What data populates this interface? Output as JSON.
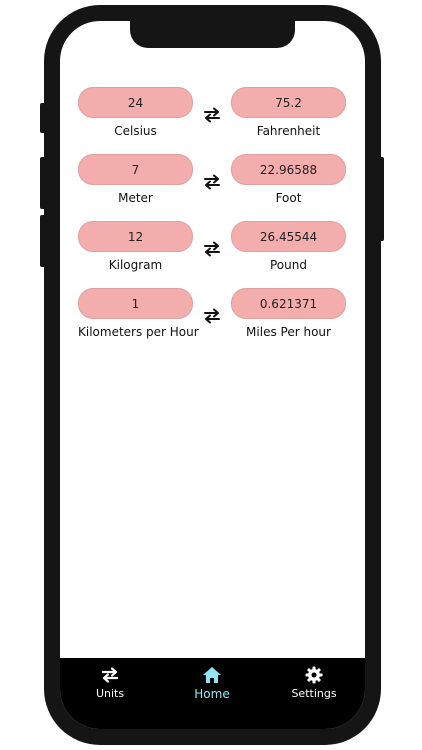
{
  "conversions": [
    {
      "left_value": "24",
      "left_unit": "Celsius",
      "right_value": "75.2",
      "right_unit": "Fahrenheit"
    },
    {
      "left_value": "7",
      "left_unit": "Meter",
      "right_value": "22.96588",
      "right_unit": "Foot"
    },
    {
      "left_value": "12",
      "left_unit": "Kilogram",
      "right_value": "26.45544",
      "right_unit": "Pound"
    },
    {
      "left_value": "1",
      "left_unit": "Kilometers per Hour",
      "right_value": "0.621371",
      "right_unit": "Miles Per hour"
    }
  ],
  "tabbar": {
    "units_label": "Units",
    "home_label": "Home",
    "settings_label": "Settings",
    "active_tab": "Home",
    "active_color": "#8ee6f2"
  },
  "icons": {
    "swap": "swap-arrows-icon",
    "units": "swap-arrows-icon",
    "home": "home-icon",
    "settings": "gear-icon"
  },
  "colors": {
    "pill_fill": "#f4adad",
    "tabbar_bg": "#000000",
    "frame": "#151515"
  }
}
